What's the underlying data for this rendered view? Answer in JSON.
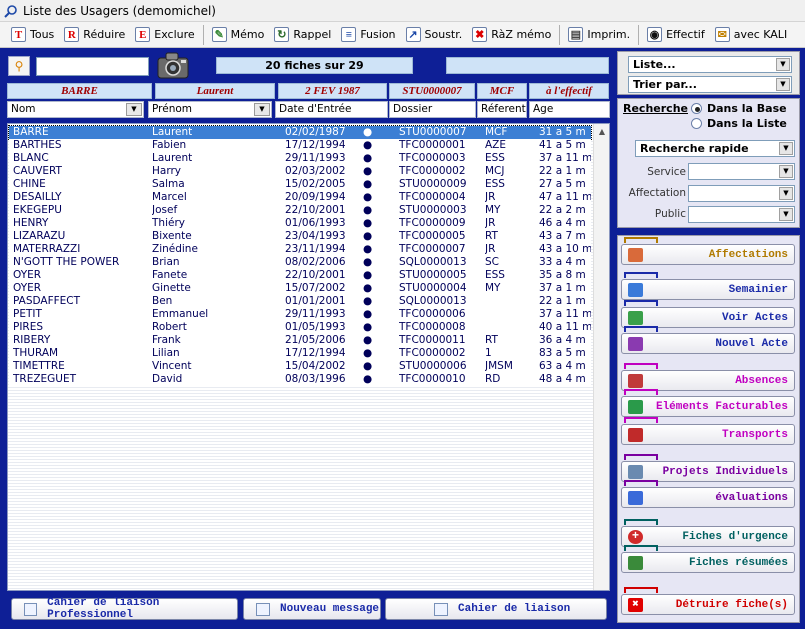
{
  "window": {
    "title": "Liste des Usagers  (demomichel)"
  },
  "toolbar": {
    "tous": "Tous",
    "reduire": "Réduire",
    "exclure": "Exclure",
    "memo": "Mémo",
    "rappel": "Rappel",
    "fusion": "Fusion",
    "soustr": "Soustr.",
    "raz_memo": "RàZ mémo",
    "imprim": "Imprim.",
    "effectif": "Effectif",
    "avec_kali": "avec KALI"
  },
  "search": {
    "value": "",
    "placeholder": ""
  },
  "count_label": "20 fiches sur 29",
  "selected_summary": {
    "nom": "BARRE",
    "prenom": "Laurent",
    "date": "2 FEV 1987",
    "dossier": "STU0000007",
    "referent": "MCF",
    "status": "à l'effectif"
  },
  "columns": {
    "nom": "Nom",
    "prenom": "Prénom",
    "date": "Date d'Entrée",
    "dossier": "Dossier",
    "referent": "Réferent",
    "age": "Age"
  },
  "rows": [
    {
      "nom": "BARRE",
      "prenom": "Laurent",
      "date": "02/02/1987",
      "dossier": "STU0000007",
      "referent": "MCF",
      "age": "31 a  5 m"
    },
    {
      "nom": "BARTHES",
      "prenom": "Fabien",
      "date": "17/12/1994",
      "dossier": "TFC0000001",
      "referent": "AZE",
      "age": "41 a  5 m"
    },
    {
      "nom": "BLANC",
      "prenom": "Laurent",
      "date": "29/11/1993",
      "dossier": "TFC0000003",
      "referent": "ESS",
      "age": "37 a 11 m"
    },
    {
      "nom": "CAUVERT",
      "prenom": "Harry",
      "date": "02/03/2002",
      "dossier": "TFC0000002",
      "referent": "MCJ",
      "age": "22 a  1 m"
    },
    {
      "nom": "CHINE",
      "prenom": "Salma",
      "date": "15/02/2005",
      "dossier": "STU0000009",
      "referent": "ESS",
      "age": "27 a  5 m"
    },
    {
      "nom": "DESAILLY",
      "prenom": "Marcel",
      "date": "20/09/1994",
      "dossier": "TFC0000004",
      "referent": "JR",
      "age": "47 a 11 m"
    },
    {
      "nom": "EKEGEPU",
      "prenom": "Josef",
      "date": "22/10/2001",
      "dossier": "STU0000003",
      "referent": "MY",
      "age": "22 a  2 m"
    },
    {
      "nom": "HENRY",
      "prenom": "Thiéry",
      "date": "01/06/1993",
      "dossier": "TFC0000009",
      "referent": "JR",
      "age": "46 a  4 m"
    },
    {
      "nom": "LIZARAZU",
      "prenom": "Bixente",
      "date": "23/04/1993",
      "dossier": "TFC0000005",
      "referent": "RT",
      "age": "43 a  7 m"
    },
    {
      "nom": "MATERRAZZI",
      "prenom": "Zinédine",
      "date": "23/11/1994",
      "dossier": "TFC0000007",
      "referent": "JR",
      "age": "43 a 10 m"
    },
    {
      "nom": "N'GOTT THE POWER",
      "prenom": "Brian",
      "date": "08/02/2006",
      "dossier": "SQL0000013",
      "referent": "SC",
      "age": "33 a  4 m"
    },
    {
      "nom": "OYER",
      "prenom": "Fanete",
      "date": "22/10/2001",
      "dossier": "STU0000005",
      "referent": "ESS",
      "age": "35 a  8 m"
    },
    {
      "nom": "OYER",
      "prenom": "Ginette",
      "date": "15/07/2002",
      "dossier": "STU0000004",
      "referent": "MY",
      "age": "37 a  1 m"
    },
    {
      "nom": "PASDAFFECT",
      "prenom": "Ben",
      "date": "01/01/2001",
      "dossier": "SQL0000013",
      "referent": "",
      "age": "22 a  1 m"
    },
    {
      "nom": "PETIT",
      "prenom": "Emmanuel",
      "date": "29/11/1993",
      "dossier": "TFC0000006",
      "referent": "",
      "age": "37 a 11 m"
    },
    {
      "nom": "PIRES",
      "prenom": "Robert",
      "date": "01/05/1993",
      "dossier": "TFC0000008",
      "referent": "",
      "age": "40 a 11 m"
    },
    {
      "nom": "RIBERY",
      "prenom": "Frank",
      "date": "21/05/2006",
      "dossier": "TFC0000011",
      "referent": "RT",
      "age": "36 a  4 m"
    },
    {
      "nom": "THURAM",
      "prenom": "Lilian",
      "date": "17/12/1994",
      "dossier": "TFC0000002",
      "referent": "1",
      "age": "83 a  5 m"
    },
    {
      "nom": "TIMETTRE",
      "prenom": "Vincent",
      "date": "15/04/2002",
      "dossier": "STU0000006",
      "referent": "JMSM",
      "age": "63 a  4 m"
    },
    {
      "nom": "TREZEGUET",
      "prenom": "David",
      "date": "08/03/1996",
      "dossier": "TFC0000010",
      "referent": "RD",
      "age": "48 a  4 m"
    }
  ],
  "row_bullet": "●",
  "bottom_buttons": {
    "cahier_pro": "Cahier de liaison Professionnel",
    "nouveau_message": "Nouveau message",
    "cahier": "Cahier de liaison"
  },
  "right_panel": {
    "liste": "Liste...",
    "trier": "Trier par...",
    "recherche_label": "Recherche",
    "dans_base": "Dans la Base",
    "dans_liste": "Dans la Liste",
    "recherche_rapide": "Recherche rapide",
    "service_label": "Service",
    "affectation_label": "Affectation",
    "public_label": "Public",
    "service_value": "",
    "affectation_value": "",
    "public_value": ""
  },
  "actions": [
    {
      "label": "Affectations",
      "color": "#b07a00",
      "icon": "bed-icon"
    },
    {
      "label": "Semainier",
      "color": "#1a2aa8",
      "icon": "calendar-icon"
    },
    {
      "label": "Voir Actes",
      "color": "#1a2aa8",
      "icon": "people-icon"
    },
    {
      "label": "Nouvel Acte",
      "color": "#1a2aa8",
      "icon": "arrow-icon"
    },
    {
      "label": "Absences",
      "color": "#c000c0",
      "icon": "list-icon"
    },
    {
      "label": "Eléments Facturables",
      "color": "#c000c0",
      "icon": "euro-icon"
    },
    {
      "label": "Transports",
      "color": "#c000c0",
      "icon": "bus-icon"
    },
    {
      "label": "Projets Individuels",
      "color": "#7a00a0",
      "icon": "disc-icon"
    },
    {
      "label": "évaluations",
      "color": "#7a00a0",
      "icon": "chart-icon"
    },
    {
      "label": "Fiches d'urgence",
      "color": "#006060",
      "icon": "cross-icon"
    },
    {
      "label": "Fiches résumées",
      "color": "#006060",
      "icon": "grid-icon"
    },
    {
      "label": "Détruire fiche(s)",
      "color": "#d00000",
      "icon": "delete-icon"
    }
  ],
  "colors": {
    "selection": "#3c7fd4",
    "background": "#0e1f96",
    "summary_text": "#a00000"
  }
}
